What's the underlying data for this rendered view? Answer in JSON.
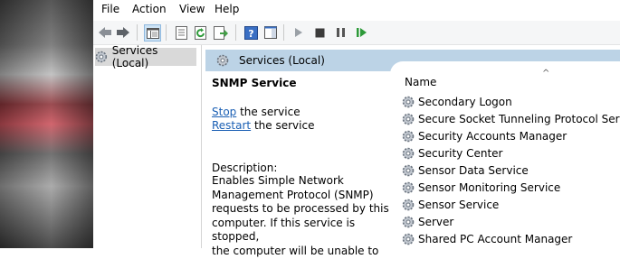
{
  "menu": {
    "file": "File",
    "action": "Action",
    "view": "View",
    "help": "Help"
  },
  "toolbar": {
    "buttons": [
      "back-icon",
      "forward-icon",
      "show-hide-console-tree-icon",
      "properties-icon",
      "refresh-icon",
      "export-list-icon",
      "help-icon",
      "show-action-pane-icon",
      "start-service-icon",
      "stop-service-icon",
      "pause-service-icon",
      "restart-service-icon"
    ]
  },
  "tree": {
    "item": "Services (Local)"
  },
  "pane": {
    "title": "Services (Local)"
  },
  "details": {
    "service_name": "SNMP Service",
    "stop_link": "Stop",
    "stop_suffix": " the service",
    "restart_link": "Restart",
    "restart_suffix": " the service",
    "description_label": "Description:",
    "description_lines": [
      "Enables Simple Network",
      "Management Protocol (SNMP)",
      "requests to be processed by this",
      "computer. If this service is stopped,",
      "the computer will be unable to"
    ]
  },
  "list": {
    "column_name": "Name",
    "sort_indicator": "^",
    "rows": [
      "Secondary Logon",
      "Secure Socket Tunneling Protocol Service",
      "Security Accounts Manager",
      "Security Center",
      "Sensor Data Service",
      "Sensor Monitoring Service",
      "Sensor Service",
      "Server",
      "Shared PC Account Manager"
    ]
  },
  "colors": {
    "header": "#bcd3e6",
    "link": "#1a5fb4",
    "selected": "#d9d9d9"
  }
}
